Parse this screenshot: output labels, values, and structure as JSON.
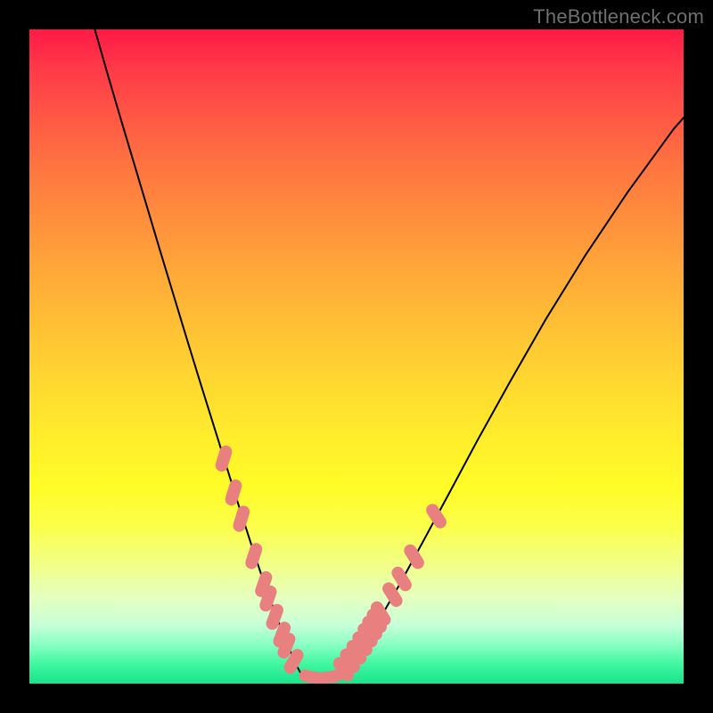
{
  "watermark": "TheBottleneck.com",
  "chart_data": {
    "type": "line",
    "title": "",
    "xlabel": "",
    "ylabel": "",
    "xlim": [
      0,
      1
    ],
    "ylim": [
      0,
      1
    ],
    "series": [
      {
        "name": "left-curve",
        "x": [
          0.1,
          0.12,
          0.14,
          0.16,
          0.18,
          0.2,
          0.22,
          0.24,
          0.26,
          0.28,
          0.3,
          0.32,
          0.34,
          0.36,
          0.372,
          0.384,
          0.396,
          0.408,
          0.418
        ],
        "y": [
          1.0,
          0.93,
          0.862,
          0.795,
          0.728,
          0.661,
          0.595,
          0.529,
          0.464,
          0.4,
          0.336,
          0.272,
          0.21,
          0.15,
          0.118,
          0.086,
          0.056,
          0.028,
          0.01
        ]
      },
      {
        "name": "floor",
        "x": [
          0.418,
          0.43,
          0.445,
          0.46,
          0.472
        ],
        "y": [
          0.01,
          0.006,
          0.004,
          0.006,
          0.01
        ]
      },
      {
        "name": "right-curve",
        "x": [
          0.472,
          0.49,
          0.51,
          0.535,
          0.565,
          0.6,
          0.64,
          0.685,
          0.735,
          0.79,
          0.85,
          0.915,
          0.985,
          1.0
        ],
        "y": [
          0.01,
          0.03,
          0.058,
          0.098,
          0.15,
          0.214,
          0.288,
          0.372,
          0.462,
          0.558,
          0.655,
          0.752,
          0.848,
          0.865
        ]
      }
    ],
    "markers": [
      {
        "shape": "pill",
        "x": 0.297,
        "y": 0.344,
        "angle": -73
      },
      {
        "shape": "pill",
        "x": 0.312,
        "y": 0.292,
        "angle": -73
      },
      {
        "shape": "pill",
        "x": 0.324,
        "y": 0.252,
        "angle": -73
      },
      {
        "shape": "pill",
        "x": 0.343,
        "y": 0.195,
        "angle": -72
      },
      {
        "shape": "pill",
        "x": 0.358,
        "y": 0.152,
        "angle": -71
      },
      {
        "shape": "pill",
        "x": 0.365,
        "y": 0.13,
        "angle": -71
      },
      {
        "shape": "pill",
        "x": 0.375,
        "y": 0.102,
        "angle": -70
      },
      {
        "shape": "pill",
        "x": 0.386,
        "y": 0.075,
        "angle": -69
      },
      {
        "shape": "pill",
        "x": 0.393,
        "y": 0.058,
        "angle": -68
      },
      {
        "shape": "pill",
        "x": 0.404,
        "y": 0.034,
        "angle": -60
      },
      {
        "shape": "dot",
        "x": 0.422,
        "y": 0.012
      },
      {
        "shape": "dot",
        "x": 0.43,
        "y": 0.01
      },
      {
        "shape": "dot",
        "x": 0.438,
        "y": 0.009
      },
      {
        "shape": "dot",
        "x": 0.446,
        "y": 0.008
      },
      {
        "shape": "dot",
        "x": 0.454,
        "y": 0.009
      },
      {
        "shape": "dot",
        "x": 0.462,
        "y": 0.01
      },
      {
        "shape": "dot",
        "x": 0.47,
        "y": 0.012
      },
      {
        "shape": "pill",
        "x": 0.48,
        "y": 0.022,
        "angle": 55
      },
      {
        "shape": "pill",
        "x": 0.49,
        "y": 0.035,
        "angle": 58
      },
      {
        "shape": "pill",
        "x": 0.5,
        "y": 0.048,
        "angle": 58
      },
      {
        "shape": "pill",
        "x": 0.509,
        "y": 0.061,
        "angle": 58
      },
      {
        "shape": "pill",
        "x": 0.517,
        "y": 0.074,
        "angle": 58
      },
      {
        "shape": "pill",
        "x": 0.524,
        "y": 0.085,
        "angle": 58
      },
      {
        "shape": "pill",
        "x": 0.531,
        "y": 0.096,
        "angle": 58
      },
      {
        "shape": "pill",
        "x": 0.537,
        "y": 0.107,
        "angle": 58
      },
      {
        "shape": "pill",
        "x": 0.555,
        "y": 0.136,
        "angle": 58
      },
      {
        "shape": "pill",
        "x": 0.569,
        "y": 0.16,
        "angle": 58
      },
      {
        "shape": "pill",
        "x": 0.588,
        "y": 0.194,
        "angle": 58
      },
      {
        "shape": "pill",
        "x": 0.622,
        "y": 0.256,
        "angle": 57
      }
    ],
    "marker_color": "#e98080",
    "curve_color": "#000000"
  }
}
